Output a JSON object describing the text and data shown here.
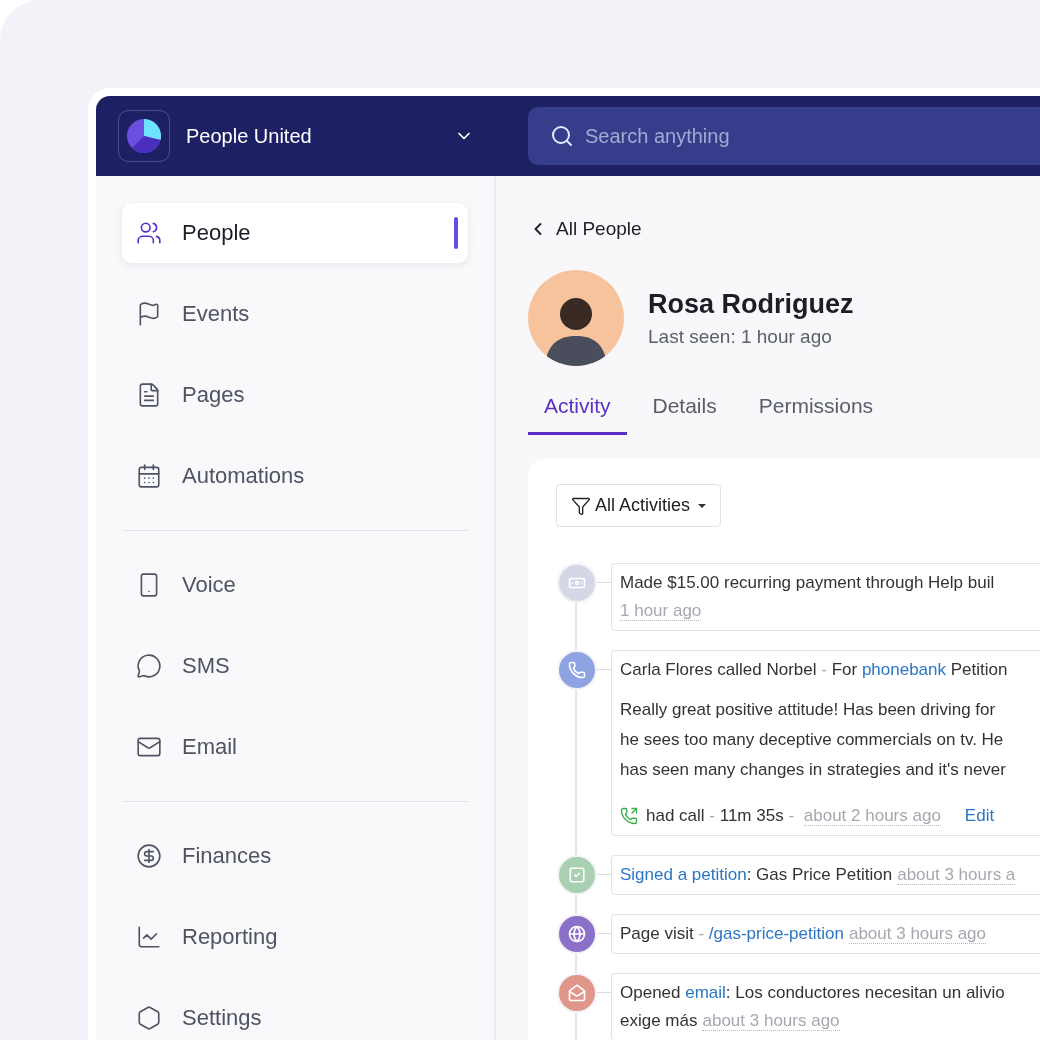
{
  "org": {
    "name": "People United"
  },
  "search": {
    "placeholder": "Search anything"
  },
  "sidebar": {
    "groups": [
      [
        {
          "label": "People",
          "kind": "people",
          "selected": true
        },
        {
          "label": "Events",
          "kind": "flag",
          "selected": false
        },
        {
          "label": "Pages",
          "kind": "page",
          "selected": false
        },
        {
          "label": "Automations",
          "kind": "calendar",
          "selected": false
        }
      ],
      [
        {
          "label": "Voice",
          "kind": "phone",
          "selected": false
        },
        {
          "label": "SMS",
          "kind": "chat",
          "selected": false
        },
        {
          "label": "Email",
          "kind": "mail",
          "selected": false
        }
      ],
      [
        {
          "label": "Finances",
          "kind": "dollar",
          "selected": false
        },
        {
          "label": "Reporting",
          "kind": "chart",
          "selected": false
        },
        {
          "label": "Settings",
          "kind": "hexagon",
          "selected": false
        }
      ]
    ]
  },
  "back_link": "All People",
  "profile": {
    "name": "Rosa Rodriguez",
    "last_seen": "Last seen: 1 hour ago"
  },
  "tabs": [
    {
      "label": "Activity",
      "selected": true
    },
    {
      "label": "Details",
      "selected": false
    },
    {
      "label": "Permissions",
      "selected": false
    }
  ],
  "filter": {
    "label": "All Activities"
  },
  "activities": [
    {
      "kind": "payment",
      "color": "#d5d7e6",
      "lines": [
        [
          {
            "text": "Made $15.00 recurring payment through Help buil",
            "kind": "plain"
          }
        ],
        [
          {
            "text": "1 hour ago",
            "kind": "time"
          }
        ]
      ]
    },
    {
      "kind": "call",
      "color": "#8ea3e1",
      "lines": [
        [
          {
            "text": "Carla Flores called Norbel",
            "kind": "plain"
          },
          {
            "text": " - ",
            "kind": "muted"
          },
          {
            "text": "For ",
            "kind": "plain"
          },
          {
            "text": "phonebank",
            "kind": "link"
          },
          {
            "text": " Petition",
            "kind": "plain"
          }
        ]
      ],
      "note": [
        "Really great positive attitude! Has been driving for",
        "he sees too many deceptive commercials on tv. He",
        "has seen many changes in strategies and it's never"
      ],
      "footer": {
        "segments": [
          {
            "text": "had call",
            "kind": "plain"
          },
          {
            "text": " - ",
            "kind": "muted"
          },
          {
            "text": "11m 35s",
            "kind": "plain"
          },
          {
            "text": " - ",
            "kind": "muted"
          },
          {
            "text": "about 2 hours ago",
            "kind": "time"
          }
        ],
        "action": "Edit"
      }
    },
    {
      "kind": "petition",
      "color": "#a8d0b1",
      "lines": [
        [
          {
            "text": "Signed a petition",
            "kind": "link"
          },
          {
            "text": ": Gas Price Petition",
            "kind": "plain"
          },
          {
            "text": "about 3 hours a",
            "kind": "time"
          }
        ]
      ]
    },
    {
      "kind": "visit",
      "color": "#8a70c9",
      "lines": [
        [
          {
            "text": "Page visit",
            "kind": "plain"
          },
          {
            "text": " - ",
            "kind": "muted"
          },
          {
            "text": "/gas-price-petition",
            "kind": "link"
          },
          {
            "text": "about 3 hours ago",
            "kind": "time"
          }
        ]
      ]
    },
    {
      "kind": "email",
      "color": "#e1968b",
      "lines": [
        [
          {
            "text": "Opened ",
            "kind": "plain"
          },
          {
            "text": "email",
            "kind": "link"
          },
          {
            "text": ": Los conductores necesitan un alivio",
            "kind": "plain"
          }
        ],
        [
          {
            "text": "exige más",
            "kind": "plain"
          },
          {
            "text": "about 3 hours ago",
            "kind": "time"
          }
        ]
      ]
    }
  ]
}
